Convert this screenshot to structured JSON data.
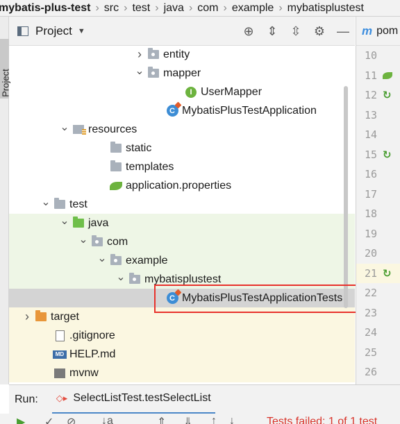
{
  "breadcrumb": [
    "mybatis-plus-test",
    "src",
    "test",
    "java",
    "com",
    "example",
    "mybatisplustest"
  ],
  "side_stripe": {
    "label": "Project"
  },
  "project_panel": {
    "title": "Project",
    "tools": [
      {
        "name": "locate-icon",
        "glyph": "⊕"
      },
      {
        "name": "expand-all-icon",
        "glyph": "⇕"
      },
      {
        "name": "collapse-all-icon",
        "glyph": "⇳"
      },
      {
        "name": "gear-icon",
        "glyph": "⚙"
      },
      {
        "name": "minimize-icon",
        "glyph": "—"
      }
    ]
  },
  "tree": [
    {
      "label": "entity",
      "icon": "package-folder-icon",
      "expanded": false,
      "depth": 7
    },
    {
      "label": "mapper",
      "icon": "package-folder-icon",
      "expanded": true,
      "depth": 7
    },
    {
      "label": "UserMapper",
      "icon": "interface-icon",
      "depth": 9
    },
    {
      "label": "MybatisPlusTestApplication",
      "icon": "spring-boot-class-icon",
      "depth": 8
    },
    {
      "label": "resources",
      "icon": "resources-folder-icon",
      "expanded": true,
      "depth": 3
    },
    {
      "label": "static",
      "icon": "folder-icon",
      "depth": 5
    },
    {
      "label": "templates",
      "icon": "folder-icon",
      "depth": 5
    },
    {
      "label": "application.properties",
      "icon": "spring-properties-icon",
      "depth": 5
    },
    {
      "label": "test",
      "icon": "folder-icon",
      "expanded": true,
      "depth": 2
    },
    {
      "label": "java",
      "icon": "test-source-folder-icon",
      "expanded": true,
      "depth": 3
    },
    {
      "label": "com",
      "icon": "package-folder-icon",
      "expanded": true,
      "depth": 4
    },
    {
      "label": "example",
      "icon": "package-folder-icon",
      "expanded": true,
      "depth": 5
    },
    {
      "label": "mybatisplustest",
      "icon": "package-folder-icon",
      "expanded": true,
      "depth": 6
    },
    {
      "label": "MybatisPlusTestApplicationTests",
      "icon": "test-class-icon",
      "depth": 8,
      "selected": true
    },
    {
      "label": "target",
      "icon": "excluded-folder-icon",
      "expanded": false,
      "depth": 1
    },
    {
      "label": ".gitignore",
      "icon": "gitignore-file-icon",
      "depth": 2
    },
    {
      "label": "HELP.md",
      "icon": "markdown-file-icon",
      "depth": 2
    },
    {
      "label": "mvnw",
      "icon": "script-file-icon",
      "depth": 2
    }
  ],
  "editor": {
    "tab_label": "pom",
    "line_numbers": [
      10,
      11,
      12,
      13,
      14,
      15,
      16,
      17,
      18,
      19,
      20,
      21,
      22,
      23,
      24,
      25,
      26
    ],
    "gutter_marks": {
      "11": "spring-leaf-icon",
      "12": "run-gutter-icon",
      "15": "run-gutter-icon",
      "21": "run-gutter-icon"
    },
    "highlighted_line": 21
  },
  "run_panel": {
    "title": "Run:",
    "tab_label": "SelectListTest.testSelectList",
    "status": "Tests failed: 1 of 1 test"
  }
}
